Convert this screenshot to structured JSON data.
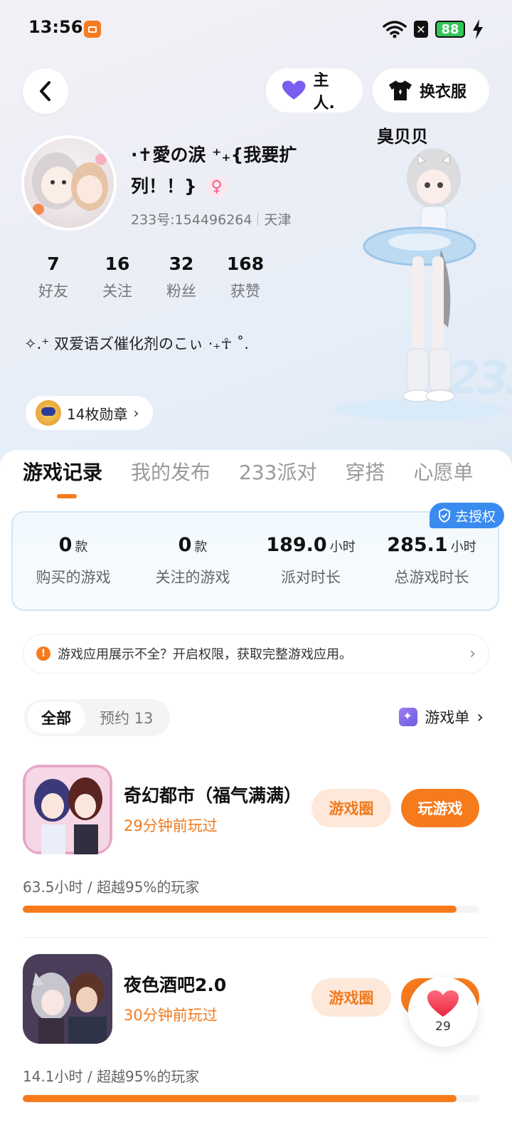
{
  "status_bar": {
    "time": "13:56",
    "battery": "88"
  },
  "header": {
    "owner_label": "主人.",
    "outfit_label": "换衣服"
  },
  "profile": {
    "nickname": "·✝愛の涙 ⁺₊{我要扩列！！}",
    "user_id": "233号:154496264",
    "location": "天津",
    "bio": "✧.⁺ 双爱语ズ催化剂のこぃ ·₊☥ ˚.",
    "medal_label": "14枚勋章",
    "character_name": "臭贝贝",
    "stats": [
      {
        "num": "7",
        "label": "好友"
      },
      {
        "num": "16",
        "label": "关注"
      },
      {
        "num": "32",
        "label": "粉丝"
      },
      {
        "num": "168",
        "label": "获赞"
      }
    ]
  },
  "tabs": [
    "游戏记录",
    "我的发布",
    "233派对",
    "穿搭",
    "心愿单"
  ],
  "summary": {
    "auth_label": "去授权",
    "items": [
      {
        "value": "0",
        "unit": "款",
        "label": "购买的游戏"
      },
      {
        "value": "0",
        "unit": "款",
        "label": "关注的游戏"
      },
      {
        "value": "189.0",
        "unit": "小时",
        "label": "派对时长"
      },
      {
        "value": "285.1",
        "unit": "小时",
        "label": "总游戏时长"
      }
    ]
  },
  "notice": "游戏应用展示不全？开启权限，获取完整游戏应用。",
  "filters": {
    "all": "全部",
    "reserve": "预约 13",
    "game_list": "游戏单"
  },
  "games": [
    {
      "title": "奇幻都市（福气满满）",
      "played": "29分钟前玩过",
      "circle_label": "游戏圈",
      "play_label": "玩游戏",
      "hours": "63.5小时 / 超越95%的玩家",
      "progress": 0.95
    },
    {
      "title": "夜色酒吧2.0",
      "played": "30分钟前玩过",
      "circle_label": "游戏圈",
      "play_label": "玩游戏",
      "hours": "14.1小时 / 超越95%的玩家",
      "progress": 0.95
    }
  ],
  "float_like": {
    "count": "29"
  }
}
